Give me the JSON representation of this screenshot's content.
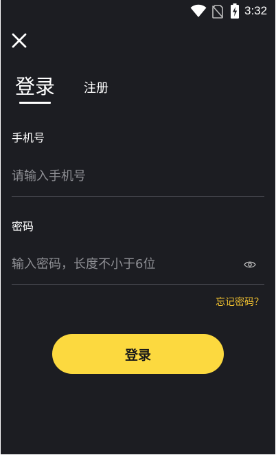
{
  "status_bar": {
    "time": "3:32",
    "icons": [
      "wifi-icon",
      "no-sim-icon",
      "battery-charging-icon"
    ]
  },
  "header": {
    "close_icon": "close-icon"
  },
  "tabs": {
    "login_label": "登录",
    "register_label": "注册",
    "active": "login"
  },
  "form": {
    "phone": {
      "label": "手机号",
      "placeholder": "请输入手机号",
      "value": ""
    },
    "password": {
      "label": "密码",
      "placeholder": "输入密码，长度不小于6位",
      "value": "",
      "toggle_icon": "eye-icon"
    },
    "forgot_label": "忘记密码？",
    "submit_label": "登录"
  },
  "colors": {
    "background": "#1c1d22",
    "accent": "#fcd93f",
    "link": "#f2c230",
    "placeholder": "#8e8f94",
    "divider": "#54565d"
  }
}
